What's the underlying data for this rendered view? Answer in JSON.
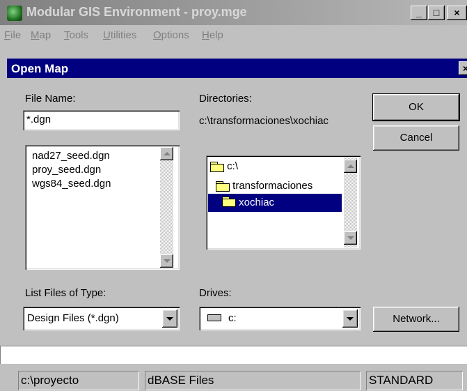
{
  "window": {
    "title": "Modular GIS Environment - proy.mge",
    "controls": {
      "minimize": "_",
      "maximize": "□",
      "close": "×"
    }
  },
  "menu": [
    "File",
    "Map",
    "Tools",
    "Utilities",
    "Options",
    "Help"
  ],
  "dialog": {
    "title": "Open Map",
    "close": "×",
    "file_name_label": "File Name:",
    "file_name_value": "*.dgn",
    "files": [
      "nad27_seed.dgn",
      "proy_seed.dgn",
      "wgs84_seed.dgn"
    ],
    "directories_label": "Directories:",
    "current_directory": "c:\\transformaciones\\xochiac",
    "directory_tree": [
      "c:\\",
      "transformaciones",
      "xochiac"
    ],
    "selected_directory": "xochiac",
    "file_type_label": "List Files of Type:",
    "file_type_value": "Design Files (*.dgn)",
    "drives_label": "Drives:",
    "drive_value": "c:",
    "ok_label": "OK",
    "cancel_label": "Cancel",
    "network_label": "Network..."
  },
  "status_bar": [
    "c:\\proyecto",
    "dBASE Files",
    "STANDARD"
  ],
  "colors": {
    "dialog_title_bg": "#000080",
    "selection_bg": "#000080",
    "face": "#c0c0c0"
  },
  "icons": [
    "app-icon",
    "folder-open-icon",
    "drive-icon",
    "scroll-up-icon",
    "scroll-down-icon",
    "dropdown-arrow-icon"
  ]
}
